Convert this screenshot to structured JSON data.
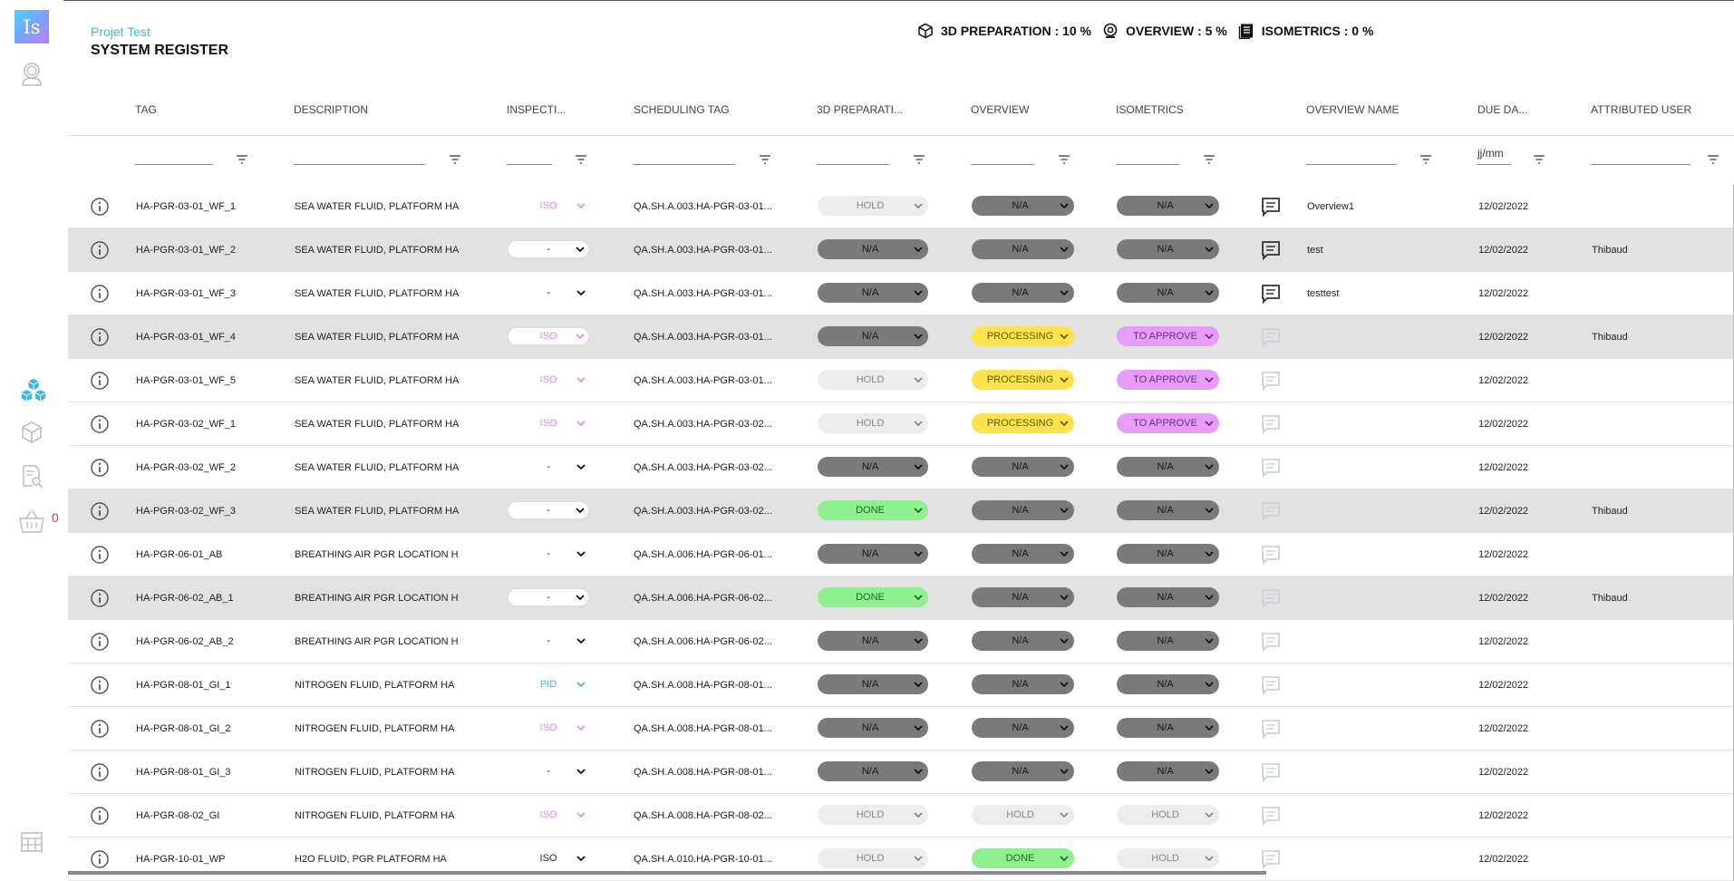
{
  "app": {
    "logo_text": "Is",
    "project": "Projet Test",
    "title": "SYSTEM REGISTER"
  },
  "stats": [
    {
      "icon": "cube-icon",
      "label": "3D PREPARATION : 10 %"
    },
    {
      "icon": "webcam-icon",
      "label": "OVERVIEW : 5 %"
    },
    {
      "icon": "document-icon",
      "label": "ISOMETRICS : 0 %"
    }
  ],
  "sidebar": {
    "basket_count": "0",
    "icons": [
      "astronaut-avatar-icon",
      "cubes-icon",
      "cube-outline-icon",
      "document-search-icon",
      "basket-icon",
      "table-icon"
    ]
  },
  "columns": [
    "TAG",
    "DESCRIPTION",
    "INSPECTI...",
    "SCHEDULING TAG",
    "3D PREPARATI...",
    "OVERVIEW",
    "ISOMETRICS",
    "OVERVIEW NAME",
    "DUE DA...",
    "ATTRIBUTED USER"
  ],
  "filters": {
    "date_placeholder": "jj/mm"
  },
  "colors": {
    "na": "#7a7a7a",
    "hold": "#ececec",
    "done": "#8ef08e",
    "processing": "#ffe34d",
    "to_approve": "#e79cf7",
    "iso": "#ee82ee",
    "pid": "#3fb5e8"
  },
  "rows": [
    {
      "tag": "HA-PGR-03-01_WF_1",
      "desc": "SEA WATER FLUID, PLATFORM HA",
      "insp": "ISO",
      "sched": "QA.SH.A.003.HA-PGR-03-01...",
      "prep": "HOLD",
      "ov": "N/A",
      "iso": "N/A",
      "oname": "Overview1",
      "due": "12/02/2022",
      "user": ""
    },
    {
      "tag": "HA-PGR-03-01_WF_2",
      "desc": "SEA WATER FLUID, PLATFORM HA",
      "insp": "-",
      "sched": "QA.SH.A.003.HA-PGR-03-01...",
      "prep": "N/A",
      "ov": "N/A",
      "iso": "N/A",
      "oname": "test",
      "due": "12/02/2022",
      "user": "Thibaud"
    },
    {
      "tag": "HA-PGR-03-01_WF_3",
      "desc": "SEA WATER FLUID, PLATFORM HA",
      "insp": "-",
      "sched": "QA.SH.A.003.HA-PGR-03-01...",
      "prep": "N/A",
      "ov": "N/A",
      "iso": "N/A",
      "oname": "testtest",
      "due": "12/02/2022",
      "user": ""
    },
    {
      "tag": "HA-PGR-03-01_WF_4",
      "desc": "SEA WATER FLUID, PLATFORM HA",
      "insp": "ISO",
      "sched": "QA.SH.A.003.HA-PGR-03-01...",
      "prep": "N/A",
      "ov": "PROCESSING",
      "iso": "TO APPROVE",
      "oname": "",
      "due": "12/02/2022",
      "user": "Thibaud"
    },
    {
      "tag": "HA-PGR-03-01_WF_5",
      "desc": "SEA WATER FLUID, PLATFORM HA",
      "insp": "ISO",
      "sched": "QA.SH.A.003.HA-PGR-03-01...",
      "prep": "HOLD",
      "ov": "PROCESSING",
      "iso": "TO APPROVE",
      "oname": "",
      "due": "12/02/2022",
      "user": ""
    },
    {
      "tag": "HA-PGR-03-02_WF_1",
      "desc": "SEA WATER FLUID, PLATFORM HA",
      "insp": "ISO",
      "sched": "QA.SH.A.003.HA-PGR-03-02...",
      "prep": "HOLD",
      "ov": "PROCESSING",
      "iso": "TO APPROVE",
      "oname": "",
      "due": "12/02/2022",
      "user": ""
    },
    {
      "tag": "HA-PGR-03-02_WF_2",
      "desc": "SEA WATER FLUID, PLATFORM HA",
      "insp": "-",
      "sched": "QA.SH.A.003.HA-PGR-03-02...",
      "prep": "N/A",
      "ov": "N/A",
      "iso": "N/A",
      "oname": "",
      "due": "12/02/2022",
      "user": ""
    },
    {
      "tag": "HA-PGR-03-02_WF_3",
      "desc": "SEA WATER FLUID, PLATFORM HA",
      "insp": "-",
      "sched": "QA.SH.A.003.HA-PGR-03-02...",
      "prep": "DONE",
      "ov": "N/A",
      "iso": "N/A",
      "oname": "",
      "due": "12/02/2022",
      "user": "Thibaud"
    },
    {
      "tag": "HA-PGR-06-01_AB",
      "desc": "BREATHING AIR PGR LOCATION H",
      "insp": "-",
      "sched": "QA.SH.A.006.HA-PGR-06-01...",
      "prep": "N/A",
      "ov": "N/A",
      "iso": "N/A",
      "oname": "",
      "due": "12/02/2022",
      "user": ""
    },
    {
      "tag": "HA-PGR-06-02_AB_1",
      "desc": "BREATHING AIR PGR LOCATION H",
      "insp": "-",
      "sched": "QA.SH.A.006.HA-PGR-06-02...",
      "prep": "DONE",
      "ov": "N/A",
      "iso": "N/A",
      "oname": "",
      "due": "12/02/2022",
      "user": "Thibaud"
    },
    {
      "tag": "HA-PGR-06-02_AB_2",
      "desc": "BREATHING AIR PGR LOCATION H",
      "insp": "-",
      "sched": "QA.SH.A.006.HA-PGR-06-02...",
      "prep": "N/A",
      "ov": "N/A",
      "iso": "N/A",
      "oname": "",
      "due": "12/02/2022",
      "user": ""
    },
    {
      "tag": "HA-PGR-08-01_GI_1",
      "desc": "NITROGEN FLUID, PLATFORM HA",
      "insp": "PID",
      "sched": "QA.SH.A.008.HA-PGR-08-01...",
      "prep": "N/A",
      "ov": "N/A",
      "iso": "N/A",
      "oname": "",
      "due": "12/02/2022",
      "user": ""
    },
    {
      "tag": "HA-PGR-08-01_GI_2",
      "desc": "NITROGEN FLUID, PLATFORM HA",
      "insp": "ISO",
      "sched": "QA.SH.A.008.HA-PGR-08-01...",
      "prep": "N/A",
      "ov": "N/A",
      "iso": "N/A",
      "oname": "",
      "due": "12/02/2022",
      "user": ""
    },
    {
      "tag": "HA-PGR-08-01_GI_3",
      "desc": "NITROGEN FLUID, PLATFORM HA",
      "insp": "-",
      "sched": "QA.SH.A.008.HA-PGR-08-01...",
      "prep": "N/A",
      "ov": "N/A",
      "iso": "N/A",
      "oname": "",
      "due": "12/02/2022",
      "user": ""
    },
    {
      "tag": "HA-PGR-08-02_GI",
      "desc": "NITROGEN FLUID, PLATFORM HA",
      "insp": "ISO",
      "sched": "QA.SH.A.008.HA-PGR-08-02...",
      "prep": "HOLD",
      "ov": "HOLD",
      "iso": "HOLD",
      "oname": "",
      "due": "12/02/2022",
      "user": ""
    },
    {
      "tag": "HA-PGR-10-01_WP",
      "desc": "H2O FLUID, PGR PLATFORM HA",
      "insp": "ISO",
      "sched": "QA.SH.A.010.HA-PGR-10-01...",
      "prep": "HOLD",
      "ov": "DONE",
      "iso": "HOLD",
      "oname": "",
      "due": "12/02/2022",
      "user": ""
    }
  ]
}
